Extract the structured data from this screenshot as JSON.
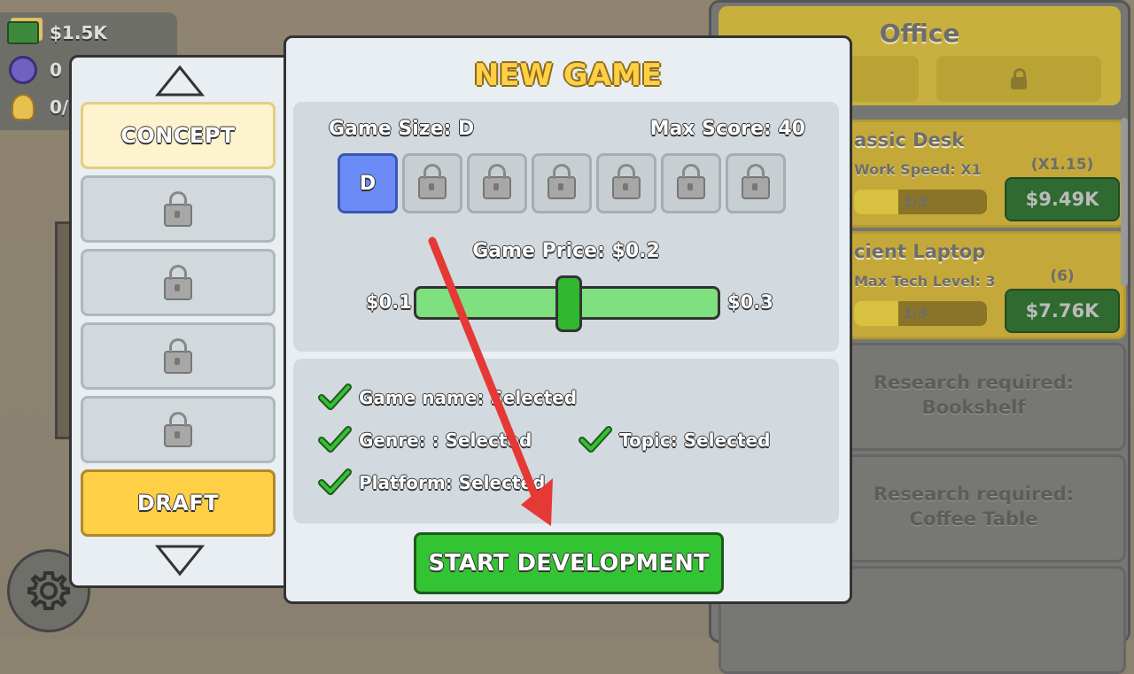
{
  "resources": {
    "money": "$1.5K",
    "gems": "0",
    "ideas": "0/"
  },
  "office": {
    "title": "Office",
    "items": [
      {
        "name": "assic Desk",
        "stat": "Work Speed: X1",
        "progress_text": "1/3",
        "progress": 0.33,
        "multiplier": "(X1.15)",
        "price": "$9.49K"
      },
      {
        "name": "cient Laptop",
        "stat": "Max Tech Level: 3",
        "progress_text": "1/3",
        "progress": 0.33,
        "multiplier": "(6)",
        "price": "$7.76K"
      }
    ],
    "research": [
      {
        "line1": "Research required:",
        "line2": "Bookshelf"
      },
      {
        "line1": "Research required:",
        "line2": "Coffee Table"
      }
    ]
  },
  "stages": {
    "items": [
      {
        "label": "CONCEPT",
        "state": "active"
      },
      {
        "label": "",
        "state": "locked"
      },
      {
        "label": "",
        "state": "locked"
      },
      {
        "label": "",
        "state": "locked"
      },
      {
        "label": "",
        "state": "locked"
      },
      {
        "label": "DRAFT",
        "state": "draft"
      }
    ]
  },
  "new_game": {
    "title": "NEW GAME",
    "game_size_label": "Game Size: D",
    "max_score_label": "Max Score: 40",
    "sizes": [
      "D",
      "",
      "",
      "",
      "",
      "",
      ""
    ],
    "selected_size": "D",
    "price_label": "Game Price: $0.2",
    "price_min": "$0.1",
    "price_max": "$0.3",
    "price_value": 0.2,
    "checks": {
      "game_name": "Game name: Selected",
      "genre": "Genre: : Selected",
      "topic": "Topic: Selected",
      "platform": "Platform: Selected"
    },
    "start_button": "START DEVELOPMENT"
  },
  "colors": {
    "accent_yellow": "#ffcf46",
    "start_green": "#33c433",
    "selected_blue": "#6b8cf6",
    "arrow_red": "#e53935"
  }
}
